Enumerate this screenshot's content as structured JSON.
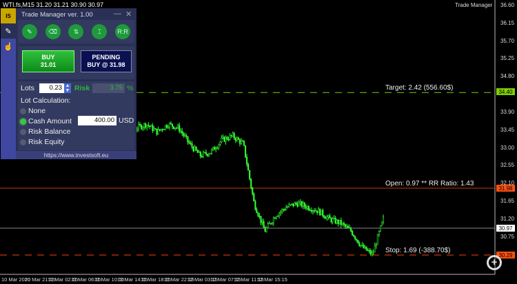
{
  "symbol_bar": "WTI.fs,M15  31.20 31.21 30.90 30.97",
  "indicator_label": "Trade Manager",
  "price_axis": [
    "36.60",
    "36.15",
    "35.70",
    "35.25",
    "34.80",
    "33.90",
    "33.45",
    "33.00",
    "32.55",
    "32.10",
    "31.65",
    "31.20",
    "30.75"
  ],
  "time_axis": [
    "10 Mar 2020",
    "10 Mar 21:15",
    "11 Mar 02:15",
    "11 Mar 06:15",
    "11 Mar 10:15",
    "11 Mar 14:15",
    "11 Mar 18:15",
    "11 Mar 22:15",
    "12 Mar 03:15",
    "12 Mar 07:15",
    "12 Mar 11:15",
    "12 Mar 15:15"
  ],
  "lines": {
    "target": {
      "price": 34.4,
      "tag": "34.40",
      "label": "Target: 2.42 (556.60$)",
      "color": "#7fd000"
    },
    "open": {
      "price": 31.98,
      "tag": "31.98",
      "label": "Open: 0.97 ** RR Ratio: 1.43",
      "color": "#c04000"
    },
    "current": {
      "price": 30.97,
      "tag": "30.97",
      "color": "#888888"
    },
    "stop": {
      "price": 30.29,
      "tag": "30.29",
      "label": "Stop: 1.69 (-388.70$)",
      "color": "#ff4000"
    }
  },
  "price_series": [
    33.8,
    33.6,
    33.3,
    33.5,
    33.6,
    33.4,
    33.6,
    33.5,
    33.1,
    32.8,
    32.9,
    33.2,
    33.3,
    33.1,
    31.6,
    30.9,
    31.3,
    31.5,
    31.6,
    31.5,
    31.4,
    31.2,
    31.1,
    30.9,
    30.5,
    30.3,
    31.2
  ],
  "panel": {
    "title": "Trade Manager ver. 1.00",
    "tools": [
      {
        "icon": "pencil-icon",
        "glyph": "✎"
      },
      {
        "icon": "eraser-icon",
        "glyph": "⌫"
      },
      {
        "icon": "reverse-icon",
        "glyph": "⇅"
      },
      {
        "icon": "breakeven-icon",
        "glyph": "⌶"
      },
      {
        "icon": "rr-icon",
        "glyph": "R:R"
      }
    ],
    "buy": {
      "line1": "BUY",
      "line2": "31.01"
    },
    "pending": {
      "line1": "PENDING",
      "line2": "BUY @ 31.98"
    },
    "lots_label": "Lots",
    "lots_value": "0.23",
    "risk_label": "Risk",
    "risk_value": "3.75",
    "risk_unit": "%",
    "lot_calc_label": "Lot Calculation:",
    "options": [
      "None",
      "Cash Amount",
      "Risk Balance",
      "Risk Equity"
    ],
    "selected_option": 1,
    "cash_value": "400.00",
    "cash_unit": "USD",
    "url": "https://www.investsoft.eu"
  }
}
